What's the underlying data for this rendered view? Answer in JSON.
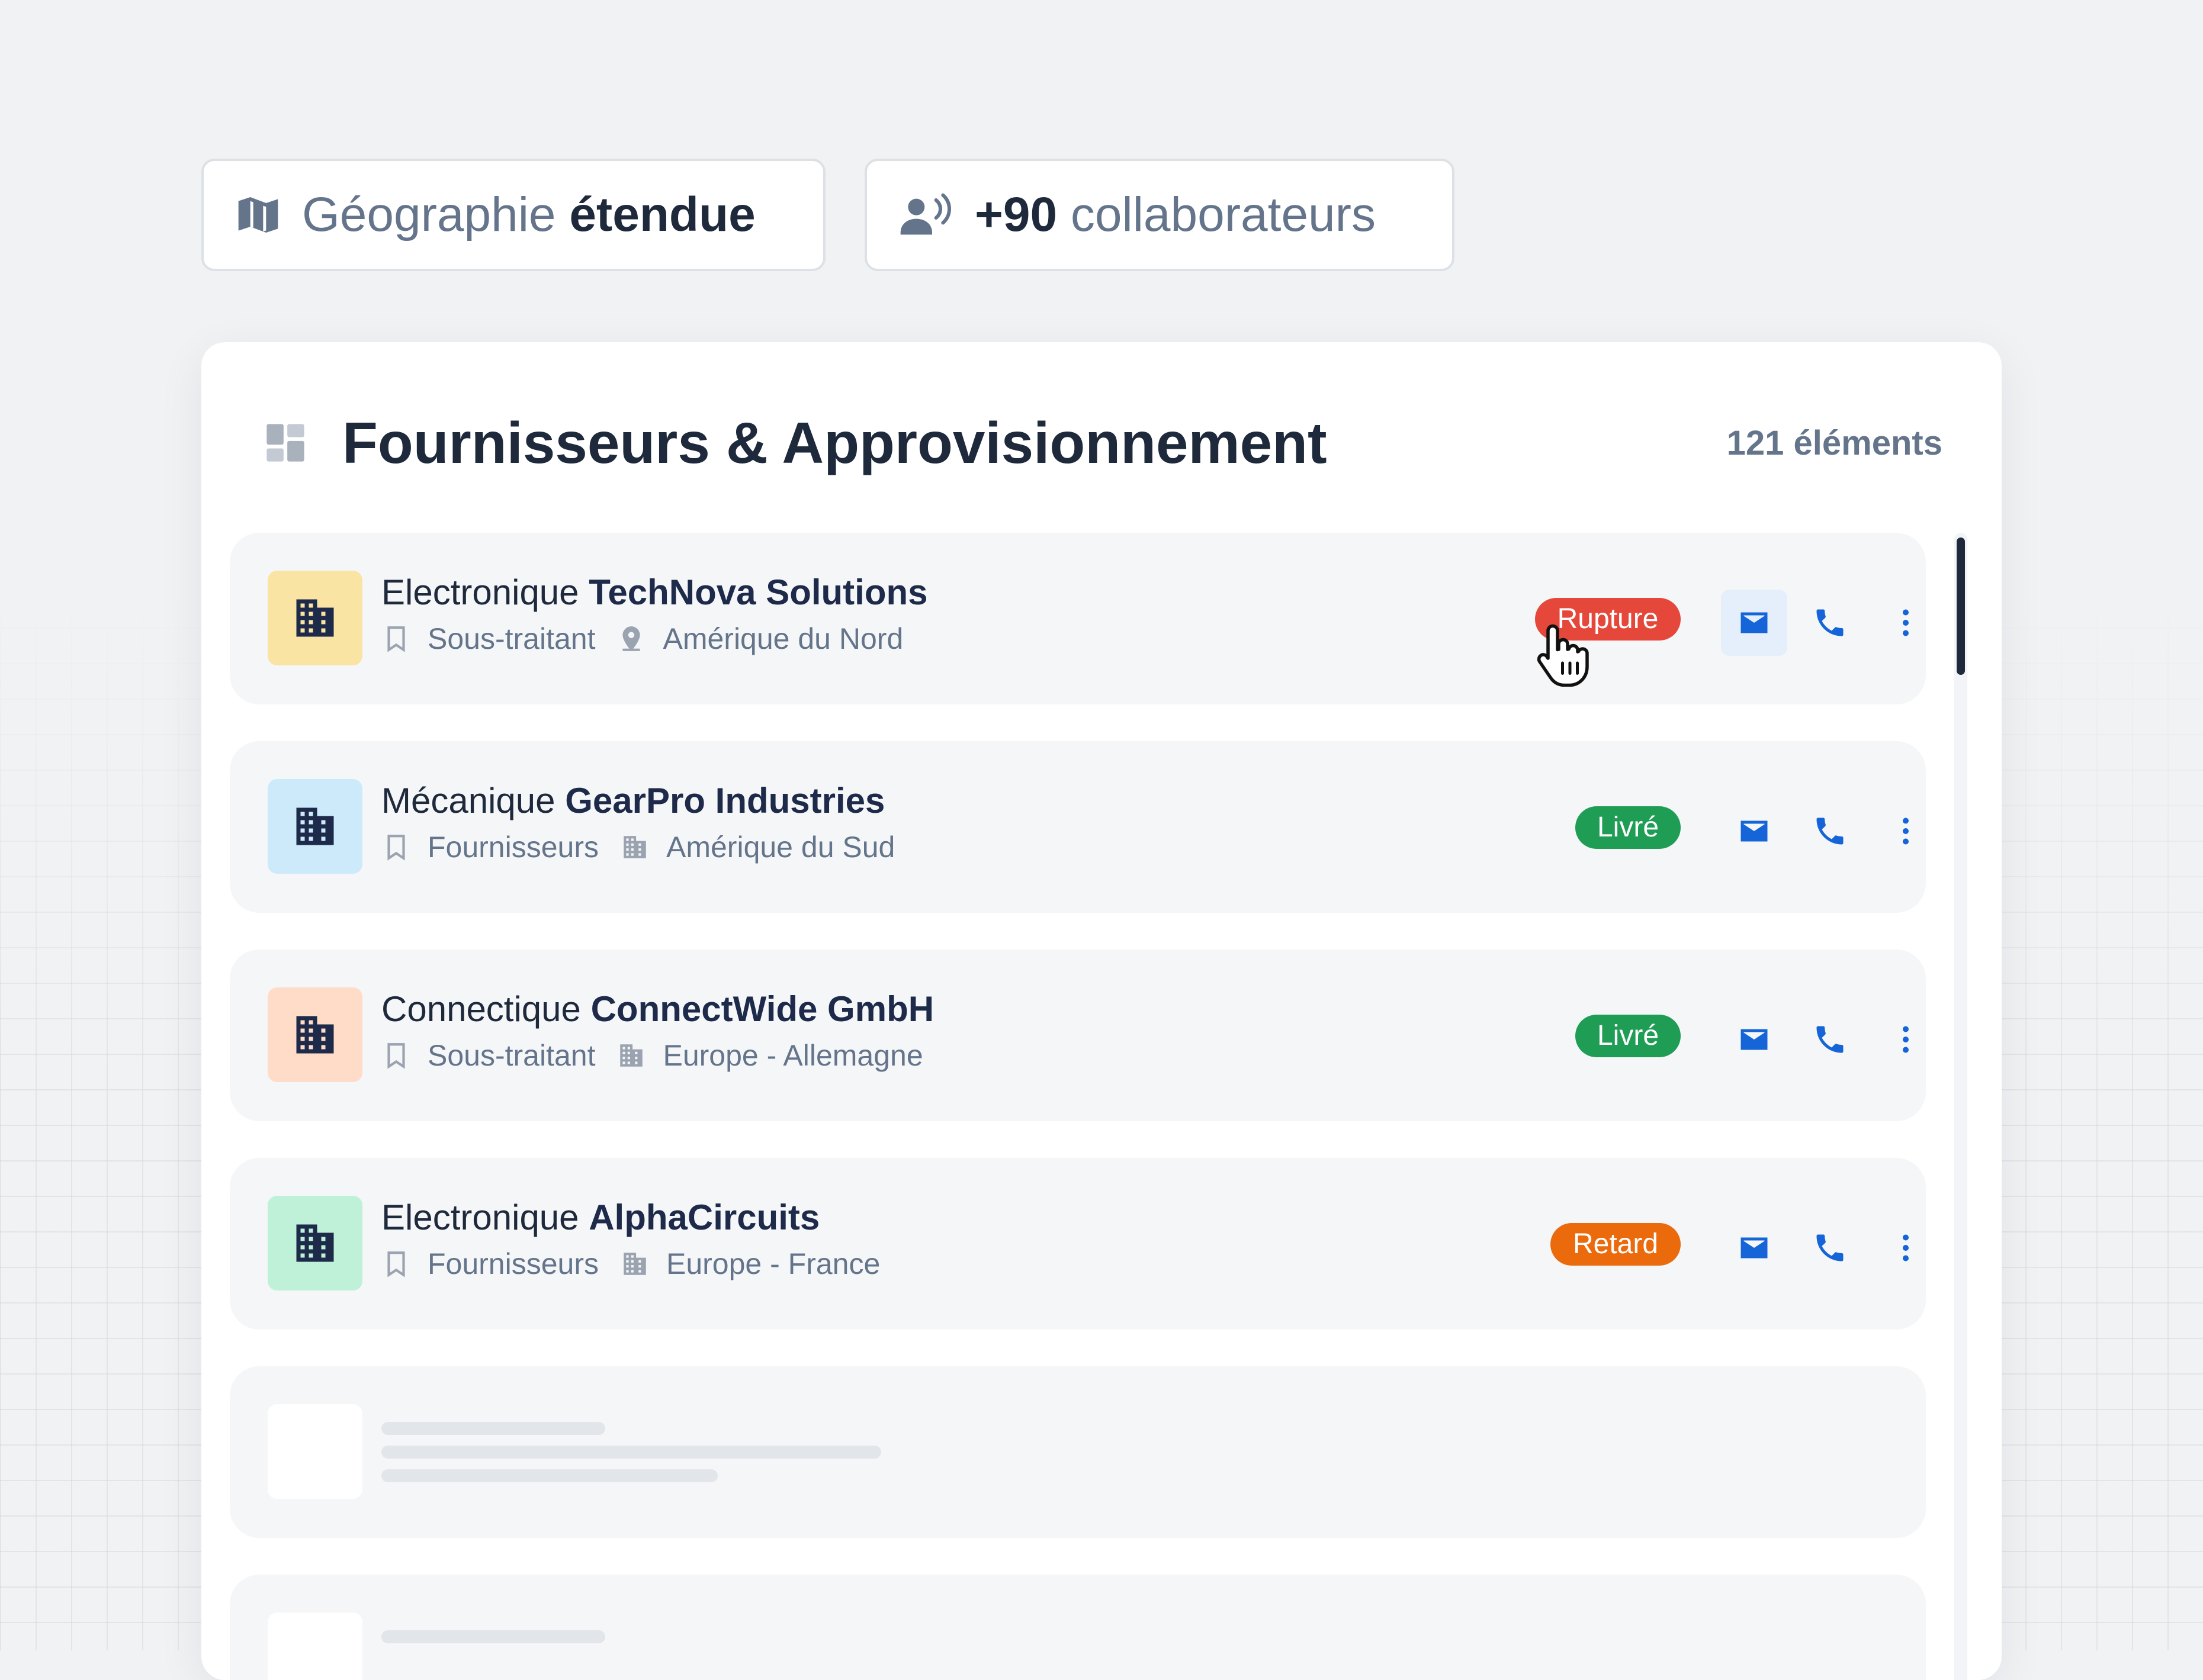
{
  "stats": [
    {
      "icon": "map-icon",
      "text_plain": "Géographie ",
      "text_bold": "étendue"
    },
    {
      "icon": "person-voice-icon",
      "text_bold": "+90",
      "text_plain": " collaborateurs"
    }
  ],
  "panel": {
    "title": "Fournisseurs & Approvisionnement",
    "count": "121 éléments"
  },
  "suppliers": [
    {
      "category": "Electronique",
      "name": "TechNova Solutions",
      "type": "Sous-traitant",
      "location": "Amérique du Nord",
      "location_icon": "pin-icon",
      "status": "Rupture",
      "status_color": "#e5483b",
      "thumb_color": "#f9e4a3"
    },
    {
      "category": "Mécanique",
      "name": "GearPro Industries",
      "type": "Fournisseurs",
      "location": "Amérique du Sud",
      "location_icon": "building-icon",
      "status": "Livré",
      "status_color": "#1f9d55",
      "thumb_color": "#cdeafb"
    },
    {
      "category": "Connectique",
      "name": "ConnectWide GmbH",
      "type": "Sous-traitant",
      "location": "Europe - Allemagne",
      "location_icon": "building-icon",
      "status": "Livré",
      "status_color": "#1f9d55",
      "thumb_color": "#ffdcc8"
    },
    {
      "category": "Electronique",
      "name": "AlphaCircuits",
      "type": "Fournisseurs",
      "location": "Europe - France",
      "location_icon": "building-icon",
      "status": "Retard",
      "status_color": "#ea6a0c",
      "thumb_color": "#bff0d8"
    }
  ],
  "colors": {
    "accent": "#1565d8",
    "text_dark": "#1e293b",
    "text_muted": "#64748b"
  }
}
